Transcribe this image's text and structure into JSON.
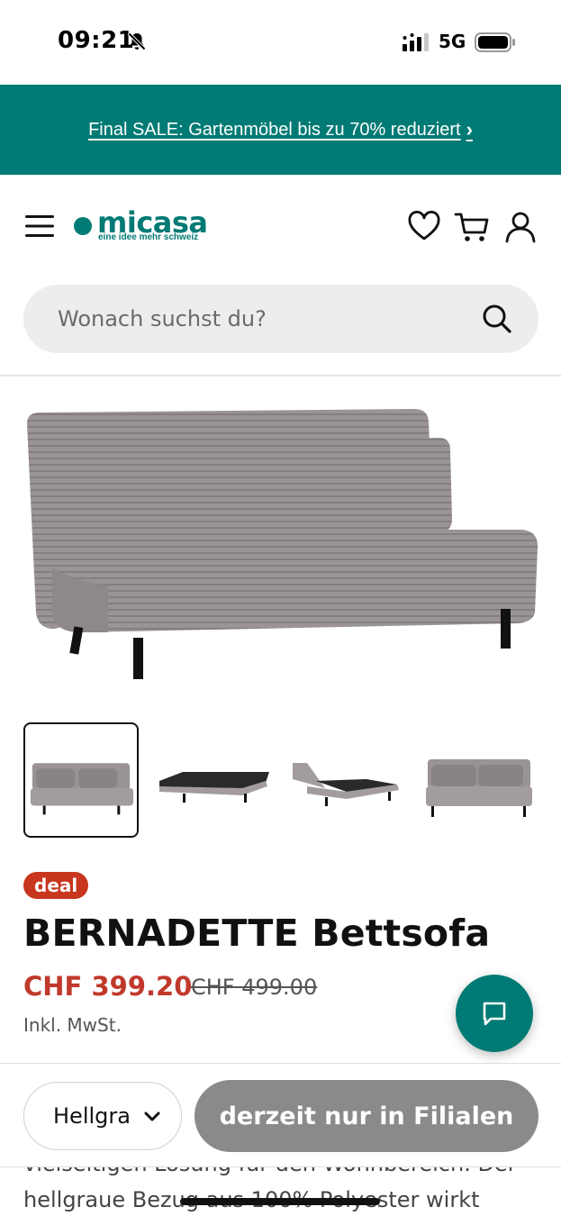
{
  "status_bar": {
    "time": "09:21",
    "network": "5G",
    "icons": [
      "bell-slash-icon",
      "signal-icon",
      "battery-icon"
    ]
  },
  "promo": {
    "text": "Final SALE: Gartenmöbel bis zu 70% reduziert",
    "chevron": "›"
  },
  "header": {
    "logo": {
      "name": "micasa",
      "tagline": "eine idee mehr schweiz"
    },
    "icons": [
      "menu-icon",
      "heart-icon",
      "cart-icon",
      "user-icon"
    ]
  },
  "search": {
    "placeholder": "Wonach suchst du?",
    "value": ""
  },
  "gallery": {
    "thumbnails": [
      "sofa-front",
      "bed-flat",
      "bed-folding",
      "sofa-side"
    ],
    "active_index": 0
  },
  "product": {
    "badge": "deal",
    "title": "BERNADETTE Bettsofa",
    "price_current": "CHF 399.20",
    "price_old": "CHF 499.00",
    "tax_note": "Inkl. MwSt."
  },
  "description": {
    "line1": "vielseitigen Lösung für den Wohnbereich. Der",
    "line2": "hellgraue Bezug aus 100% Polyester wirkt"
  },
  "action_bar": {
    "variant_value": "Hellgrau",
    "store_button": "derzeit nur in Filialen"
  },
  "colors": {
    "brand": "#007a74",
    "sale": "#c0392b",
    "badge": "#c8361d",
    "disabled_button": "#8a8a8a"
  }
}
